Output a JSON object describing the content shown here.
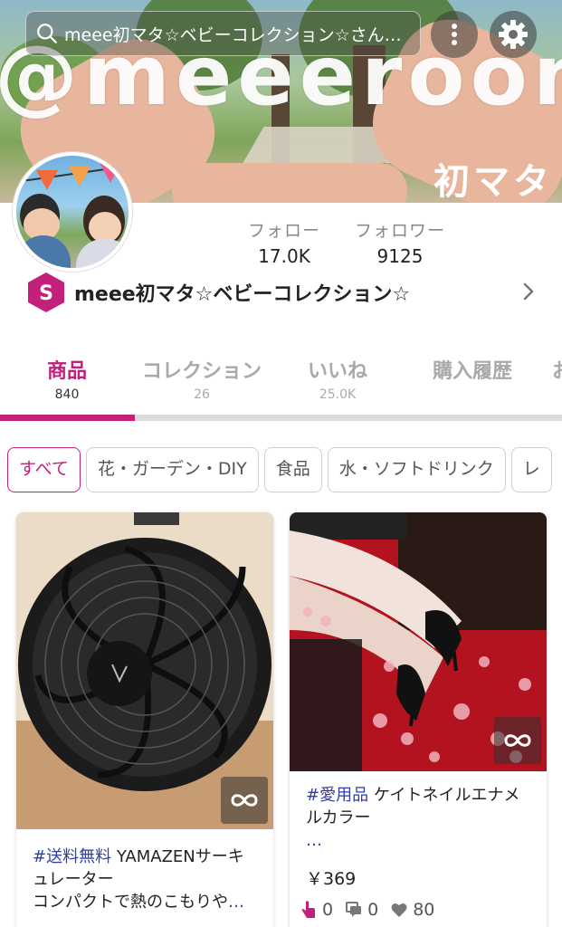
{
  "header": {
    "search_text": "meee初マタ☆ベビーコレクション☆さん…",
    "cover_watermark": "@meeeroom",
    "cover_watermark_jp": "初マタ"
  },
  "profile": {
    "following_label": "フォロー",
    "following_value": "17.0K",
    "followers_label": "フォロワー",
    "followers_value": "9125",
    "shop_badge_letter": "S",
    "shop_name": "meee初マタ☆ベビーコレクション☆"
  },
  "tabs": [
    {
      "label": "商品",
      "count": "840",
      "active": true
    },
    {
      "label": "コレクション",
      "count": "26",
      "active": false
    },
    {
      "label": "いいね",
      "count": "25.0K",
      "active": false
    },
    {
      "label": "購入履歴",
      "count": "",
      "active": false
    },
    {
      "label": "お",
      "count": "",
      "active": false
    }
  ],
  "chips": [
    {
      "label": "すべて",
      "active": true
    },
    {
      "label": "花・ガーデン・DIY",
      "active": false
    },
    {
      "label": "食品",
      "active": false
    },
    {
      "label": "水・ソフトドリンク",
      "active": false
    },
    {
      "label": "レ",
      "active": false
    }
  ],
  "products": [
    {
      "tag": "#送料無料",
      "title_line1": " YAMAZENサーキ",
      "title_line2": "ュレーター",
      "title_line3": "コンパクトで熱のこもりや",
      "ellipsis": "…"
    },
    {
      "tag": "#愛用品",
      "title_line1": " ケイトネイルエナメ",
      "title_line2": "ルカラー",
      "ellipsis": "…",
      "price": "￥369",
      "clicks": "0",
      "comments": "0",
      "likes": "80"
    }
  ],
  "colors": {
    "accent": "#c3207b",
    "tag_link": "#2f3da8"
  },
  "icons": [
    "search-icon",
    "more-vertical-icon",
    "gear-icon",
    "chevron-right-icon",
    "loop-icon",
    "pointer-icon",
    "comment-icon",
    "heart-icon"
  ]
}
